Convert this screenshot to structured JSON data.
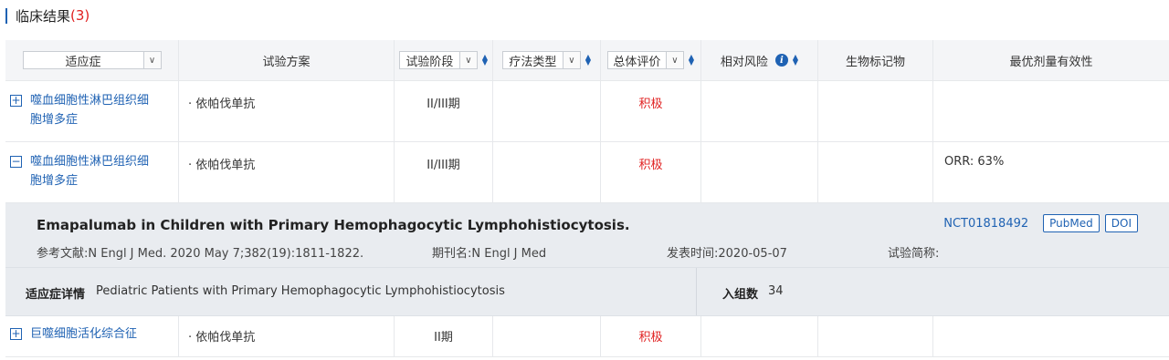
{
  "section": {
    "title": "临床结果",
    "count": "(3)"
  },
  "header": {
    "indication_label": "适应症",
    "plan": "试验方案",
    "phase_label": "试验阶段",
    "therapy_label": "疗法类型",
    "evaluation_label": "总体评价",
    "relative_risk": "相对风险",
    "biomarker": "生物标记物",
    "best_dose": "最优剂量有效性",
    "info_glyph": "i"
  },
  "rows": [
    {
      "toggle": "+",
      "indication": "噬血细胞性淋巴组织细胞增多症",
      "drug": "· 依帕伐单抗",
      "phase": "II/III期",
      "therapy": "",
      "evaluation": "积极",
      "risk": "",
      "biomarker": "",
      "efficacy": ""
    },
    {
      "toggle": "−",
      "indication": "噬血细胞性淋巴组织细胞增多症",
      "drug": "· 依帕伐单抗",
      "phase": "II/III期",
      "therapy": "",
      "evaluation": "积极",
      "risk": "",
      "biomarker": "",
      "efficacy": "ORR: 63%"
    }
  ],
  "detail": {
    "title": "Emapalumab in Children with Primary Hemophagocytic Lymphohistiocytosis.",
    "nct": "NCT01818492",
    "pubmed": "PubMed",
    "doi": "DOI",
    "reference": "参考文献:N Engl J Med. 2020 May 7;382(19):1811-1822.",
    "journal": "期刊名:N Engl J Med",
    "published": "发表时间:2020-05-07",
    "short_name": "试验简称:",
    "indication_detail_label": "适应症详情",
    "indication_detail_value": "Pediatric Patients with Primary Hemophagocytic Lymphohistiocytosis",
    "enrollment_label": "入组数",
    "enrollment_value": "34"
  },
  "last_row": {
    "toggle": "+",
    "indication": "巨噬细胞活化综合征",
    "drug": "· 依帕伐单抗",
    "phase": "II期",
    "evaluation": "积极"
  }
}
